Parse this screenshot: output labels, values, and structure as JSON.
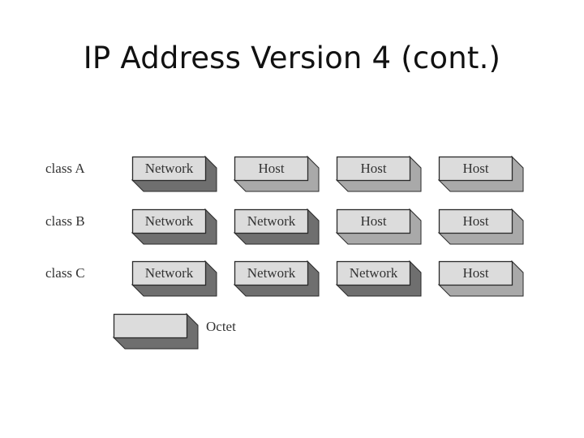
{
  "title": "IP Address Version 4 (cont.)",
  "colors": {
    "face": "#dcdcdc",
    "network_shadow": "#6f6f6f",
    "host_shadow": "#a9a9a9",
    "outline": "#2a2a2a"
  },
  "rows": [
    {
      "label": "class A",
      "octets": [
        {
          "label": "Network",
          "type": "network"
        },
        {
          "label": "Host",
          "type": "host"
        },
        {
          "label": "Host",
          "type": "host"
        },
        {
          "label": "Host",
          "type": "host"
        }
      ]
    },
    {
      "label": "class B",
      "octets": [
        {
          "label": "Network",
          "type": "network"
        },
        {
          "label": "Network",
          "type": "network"
        },
        {
          "label": "Host",
          "type": "host"
        },
        {
          "label": "Host",
          "type": "host"
        }
      ]
    },
    {
      "label": "class C",
      "octets": [
        {
          "label": "Network",
          "type": "network"
        },
        {
          "label": "Network",
          "type": "network"
        },
        {
          "label": "Network",
          "type": "network"
        },
        {
          "label": "Host",
          "type": "host"
        }
      ]
    }
  ],
  "legend": {
    "label": "Octet",
    "type": "network"
  }
}
